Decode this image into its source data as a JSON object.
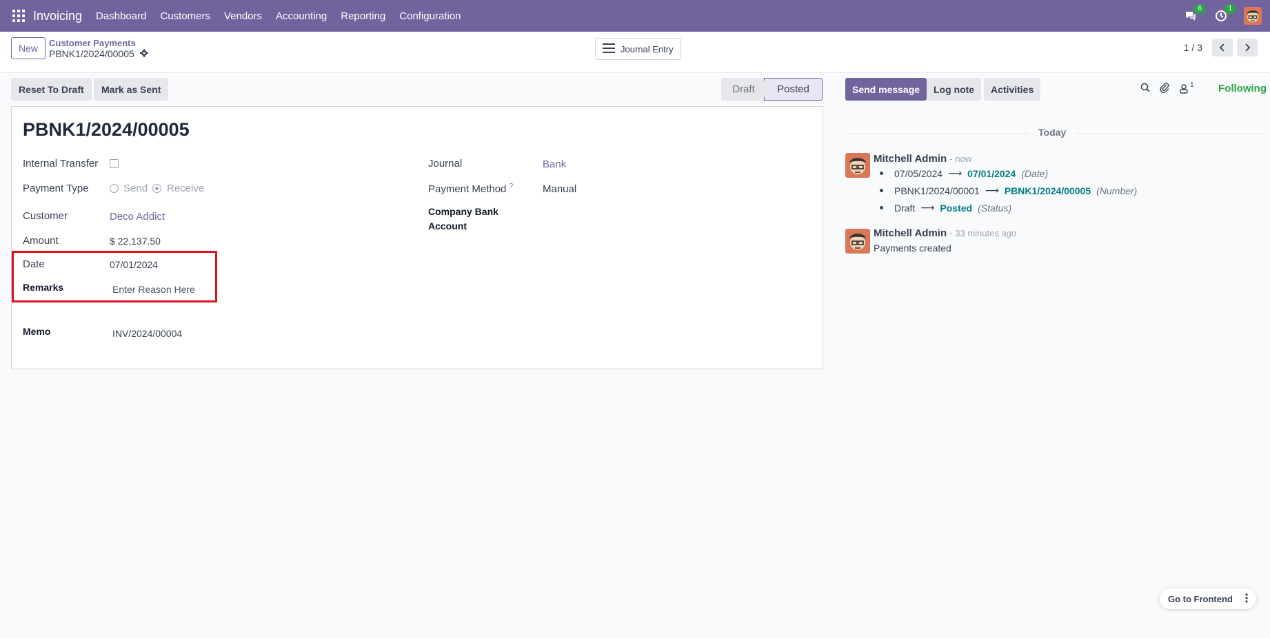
{
  "nav": {
    "brand": "Invoicing",
    "items": [
      "Dashboard",
      "Customers",
      "Vendors",
      "Accounting",
      "Reporting",
      "Configuration"
    ],
    "messages_count": "6",
    "activities_count": "1"
  },
  "control": {
    "new_label": "New",
    "breadcrumb": "Customer Payments",
    "record": "PBNK1/2024/00005",
    "journal_entry_label": "Journal Entry",
    "pager": "1 / 3"
  },
  "statusbar": {
    "reset_label": "Reset To Draft",
    "mark_sent_label": "Mark as Sent",
    "stages": [
      "Draft",
      "Posted"
    ],
    "current_stage": "Posted"
  },
  "form": {
    "title": "PBNK1/2024/00005",
    "internal_transfer_label": "Internal Transfer",
    "payment_type_label": "Payment Type",
    "payment_type_send": "Send",
    "payment_type_receive": "Receive",
    "customer_label": "Customer",
    "customer_value": "Deco Addict",
    "amount_label": "Amount",
    "amount_value": "$ 22,137.50",
    "date_label": "Date",
    "date_value": "07/01/2024",
    "remarks_label": "Remarks",
    "remarks_placeholder": "Enter Reason Here",
    "memo_label": "Memo",
    "memo_value": "INV/2024/00004",
    "journal_label": "Journal",
    "journal_value": "Bank",
    "payment_method_label": "Payment Method",
    "payment_method_help": "?",
    "payment_method_value": "Manual",
    "company_bank_label_1": "Company Bank",
    "company_bank_label_2": "Account"
  },
  "chatter": {
    "send_message": "Send message",
    "log_note": "Log note",
    "activities": "Activities",
    "followers_count": "1",
    "following": "Following",
    "today": "Today",
    "messages": [
      {
        "author": "Mitchell Admin",
        "time": "- now",
        "tracking": [
          {
            "old": "07/05/2024",
            "new": "07/01/2024",
            "field": "(Date)"
          },
          {
            "old": "PBNK1/2024/00001",
            "new": "PBNK1/2024/00005",
            "field": "(Number)"
          },
          {
            "old": "Draft",
            "new": "Posted",
            "field": "(Status)"
          }
        ]
      },
      {
        "author": "Mitchell Admin",
        "time": "- 33 minutes ago",
        "body": "Payments created"
      }
    ]
  },
  "footer": {
    "frontend_label": "Go to Frontend"
  }
}
